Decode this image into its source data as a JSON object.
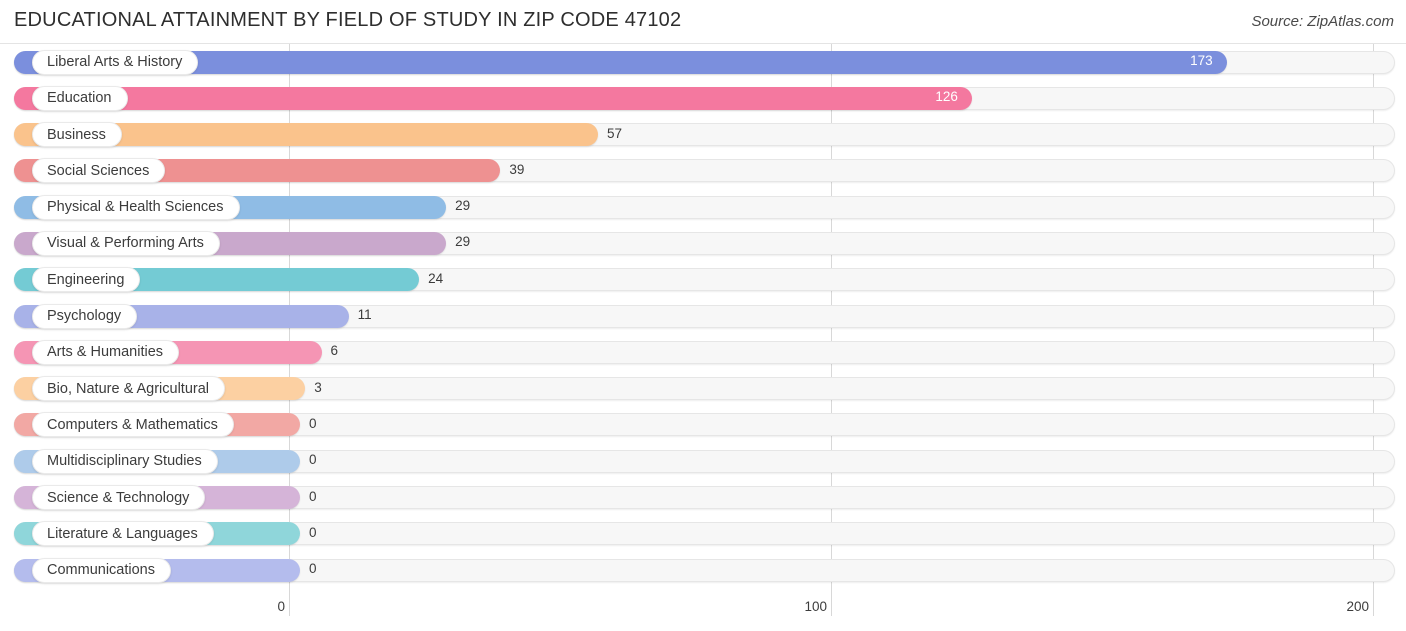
{
  "header": {
    "title": "EDUCATIONAL ATTAINMENT BY FIELD OF STUDY IN ZIP CODE 47102",
    "source": "Source: ZipAtlas.com"
  },
  "chart_data": {
    "type": "bar",
    "orientation": "horizontal",
    "title": "EDUCATIONAL ATTAINMENT BY FIELD OF STUDY IN ZIP CODE 47102",
    "xlabel": "",
    "ylabel": "",
    "xlim": [
      0,
      200
    ],
    "xticks": [
      "0",
      "100",
      "200"
    ],
    "xtick_values": [
      0,
      100,
      200
    ],
    "grid": true,
    "legend": false,
    "categories": [
      "Liberal Arts & History",
      "Education",
      "Business",
      "Social Sciences",
      "Physical & Health Sciences",
      "Visual & Performing Arts",
      "Engineering",
      "Psychology",
      "Arts & Humanities",
      "Bio, Nature & Agricultural",
      "Computers & Mathematics",
      "Multidisciplinary Studies",
      "Science & Technology",
      "Literature & Languages",
      "Communications"
    ],
    "values": [
      173,
      126,
      57,
      39,
      29,
      29,
      24,
      11,
      6,
      3,
      0,
      0,
      0,
      0,
      0
    ],
    "value_labels": [
      "173",
      "126",
      "57",
      "39",
      "29",
      "29",
      "24",
      "11",
      "6",
      "3",
      "0",
      "0",
      "0",
      "0",
      "0"
    ],
    "colors": [
      "#7b8fdd",
      "#f4789f",
      "#fac38c",
      "#ee9191",
      "#8fbce5",
      "#c9a8cc",
      "#74cbd4",
      "#a8b2e8",
      "#f595b4",
      "#fcd0a2",
      "#f2a8a4",
      "#aecbea",
      "#d5b4d8",
      "#8fd6da",
      "#b4bced"
    ]
  }
}
